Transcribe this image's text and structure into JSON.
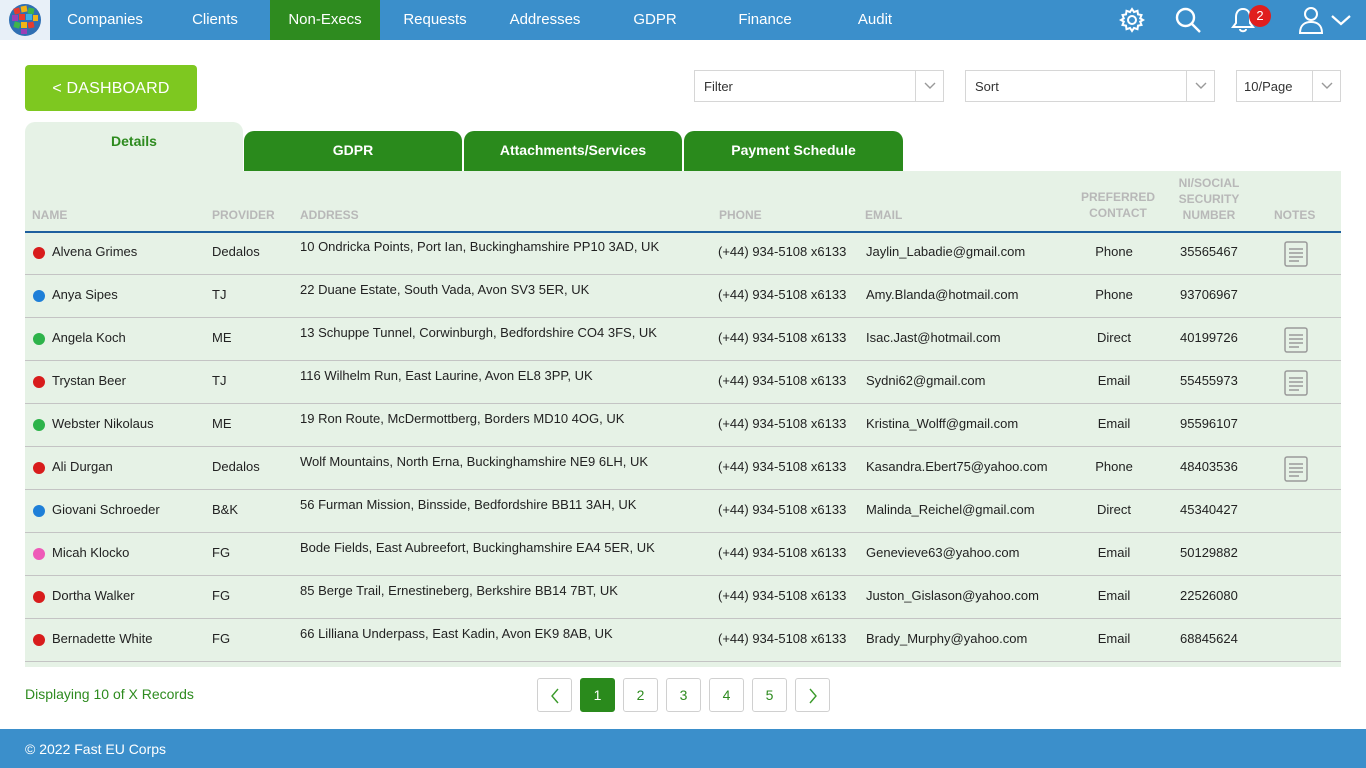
{
  "nav": {
    "items": [
      "Companies",
      "Clients",
      "Non-Execs",
      "Requests",
      "Addresses",
      "GDPR",
      "Finance",
      "Audit"
    ],
    "active": "Non-Execs",
    "notification_count": "2",
    "icons": [
      "logo-icon",
      "gear-icon",
      "search-icon",
      "bell-icon",
      "user-icon",
      "chevron-down-icon"
    ]
  },
  "toolbar": {
    "dashboard_label": "< DASHBOARD",
    "filter_label": "Filter",
    "sort_label": "Sort",
    "per_page_label": "10/Page"
  },
  "tabs": [
    "Details",
    "GDPR",
    "Attachments/Services",
    "Payment Schedule"
  ],
  "table": {
    "headers": {
      "name": "NAME",
      "provider": "PROVIDER",
      "address": "ADDRESS",
      "phone": "PHONE",
      "email": "EMAIL",
      "preferred": [
        "PREFERRED",
        "CONTACT"
      ],
      "ni": [
        "NI/SOCIAL",
        "SECURITY",
        "NUMBER"
      ],
      "notes": "NOTES"
    },
    "rows": [
      {
        "name": "Alvena Grimes",
        "provider": "Dedalos",
        "address": "10 Ondricka Points, Port Ian, Buckinghamshire PP10 3AD, UK",
        "phone": "(+44) 934-5108 x6133",
        "email": "Jaylin_Labadie@gmail.com",
        "contact": "Phone",
        "ni": "35565467",
        "dot_color": "#d81c1c",
        "has_note": true
      },
      {
        "name": "Anya Sipes",
        "provider": "TJ",
        "address": "22 Duane Estate, South Vada, Avon SV3 5ER, UK",
        "phone": "(+44) 934-5108 x6133",
        "email": "Amy.Blanda@hotmail.com",
        "contact": "Phone",
        "ni": "93706967",
        "dot_color": "#1e7fd8",
        "has_note": false
      },
      {
        "name": "Angela Koch",
        "provider": "ME",
        "address": "13 Schuppe Tunnel, Corwinburgh, Bedfordshire CO4 3FS, UK",
        "phone": "(+44) 934-5108 x6133",
        "email": "Isac.Jast@hotmail.com",
        "contact": "Direct",
        "ni": "40199726",
        "dot_color": "#2db34a",
        "has_note": true
      },
      {
        "name": "Trystan Beer",
        "provider": "TJ",
        "address": "116 Wilhelm Run, East Laurine, Avon EL8 3PP, UK",
        "phone": "(+44) 934-5108 x6133",
        "email": "Sydni62@gmail.com",
        "contact": "Email",
        "ni": "55455973",
        "dot_color": "#d81c1c",
        "has_note": true
      },
      {
        "name": "Webster Nikolaus",
        "provider": "ME",
        "address": "19 Ron Route, McDermottberg, Borders MD10 4OG, UK",
        "phone": "(+44) 934-5108 x6133",
        "email": "Kristina_Wolff@gmail.com",
        "contact": "Email",
        "ni": "95596107",
        "dot_color": "#2db34a",
        "has_note": false
      },
      {
        "name": "Ali Durgan",
        "provider": "Dedalos",
        "address": "Wolf Mountains, North Erna, Buckinghamshire NE9 6LH, UK",
        "phone": "(+44) 934-5108 x6133",
        "email": "Kasandra.Ebert75@yahoo.com",
        "contact": "Phone",
        "ni": "48403536",
        "dot_color": "#d81c1c",
        "has_note": true
      },
      {
        "name": "Giovani Schroeder",
        "provider": "B&K",
        "address": "56 Furman Mission, Binsside, Bedfordshire BB11 3AH, UK",
        "phone": "(+44) 934-5108 x6133",
        "email": "Malinda_Reichel@gmail.com",
        "contact": "Direct",
        "ni": "45340427",
        "dot_color": "#1e7fd8",
        "has_note": false
      },
      {
        "name": "Micah Klocko",
        "provider": "FG",
        "address": "Bode Fields, East Aubreefort, Buckinghamshire EA4 5ER, UK",
        "phone": "(+44) 934-5108 x6133",
        "email": "Genevieve63@yahoo.com",
        "contact": "Email",
        "ni": "50129882",
        "dot_color": "#ee5ab8",
        "has_note": false
      },
      {
        "name": "Dortha Walker",
        "provider": "FG",
        "address": "85 Berge Trail, Ernestineberg, Berkshire BB14 7BT, UK",
        "phone": "(+44) 934-5108 x6133",
        "email": "Juston_Gislason@yahoo.com",
        "contact": "Email",
        "ni": "22526080",
        "dot_color": "#d81c1c",
        "has_note": false
      },
      {
        "name": "Bernadette White",
        "provider": "FG",
        "address": "66 Lilliana Underpass, East Kadin, Avon EK9 8AB, UK",
        "phone": "(+44) 934-5108 x6133",
        "email": "Brady_Murphy@yahoo.com",
        "contact": "Email",
        "ni": "68845624",
        "dot_color": "#d81c1c",
        "has_note": false
      }
    ]
  },
  "pagination": {
    "status": "Displaying 10 of X Records",
    "pages": [
      "1",
      "2",
      "3",
      "4",
      "5"
    ],
    "current": "1"
  },
  "footer": {
    "copyright": "© 2022 Fast EU Corps"
  },
  "colors": {
    "nav_bg": "#3b8fcb",
    "active_green": "#2e8b1f",
    "dashboard_green": "#7ec820",
    "panel_bg": "#e6f2e6"
  }
}
